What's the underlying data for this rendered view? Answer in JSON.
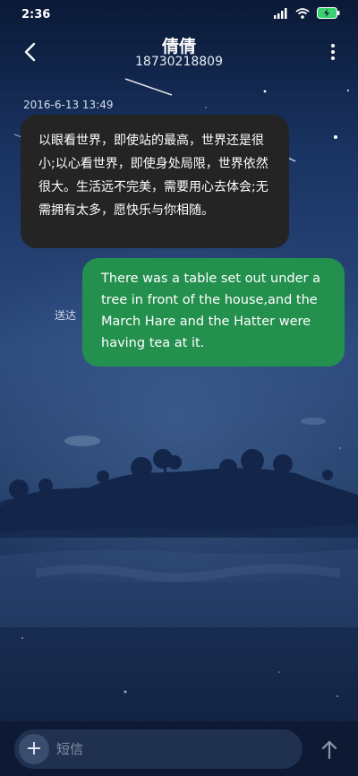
{
  "status": {
    "time": "2:36"
  },
  "header": {
    "title": "倩倩",
    "phone": "18730218809"
  },
  "conversation": {
    "timestamp": "2016-6-13 13:49",
    "incoming_text": "以眼看世界，即使站的最高，世界还是很小;以心看世界，即使身处局限，世界依然很大。生活远不完美，需要用心去体会;无需拥有太多，愿快乐与你相随。",
    "outgoing_text": "There was a table set out under a tree in front of the house,and the March Hare and the Hatter were having tea at it.",
    "delivered_label": "送达"
  },
  "composer": {
    "add_symbol": "+",
    "placeholder": "短信"
  },
  "colors": {
    "incoming_bubble": "#242424",
    "outgoing_bubble": "#24904e",
    "battery": "#3bd16f"
  },
  "icons": [
    "signal-icon",
    "wifi-icon",
    "battery-charging-icon",
    "back-arrow-icon",
    "more-vertical-icon",
    "add-icon",
    "send-arrow-icon"
  ]
}
